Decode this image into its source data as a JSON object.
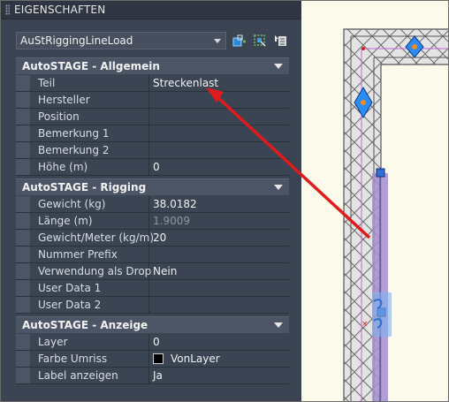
{
  "palette": {
    "title": "EIGENSCHAFTEN"
  },
  "object_selector": {
    "value": "AuStRiggingLineLoad"
  },
  "toolbar": {
    "icons": [
      "quick-select-icon",
      "select-objects-icon",
      "toggle-pickadd-icon"
    ]
  },
  "categories": [
    {
      "title": "AutoSTAGE - Allgemein",
      "rows": [
        {
          "name": "Teil",
          "value": "Streckenlast"
        },
        {
          "name": "Hersteller",
          "value": ""
        },
        {
          "name": "Position",
          "value": ""
        },
        {
          "name": "Bemerkung 1",
          "value": ""
        },
        {
          "name": "Bemerkung 2",
          "value": ""
        },
        {
          "name": "Höhe (m)",
          "value": "0"
        }
      ]
    },
    {
      "title": "AutoSTAGE - Rigging",
      "rows": [
        {
          "name": "Gewicht (kg)",
          "value": "38.0182"
        },
        {
          "name": "Länge (m)",
          "value": "1.9009"
        },
        {
          "name": "Gewicht/Meter (kg/m)",
          "value": "20"
        },
        {
          "name": "Nummer Prefix",
          "value": ""
        },
        {
          "name": "Verwendung als Drop",
          "value": "Nein"
        },
        {
          "name": "User Data 1",
          "value": ""
        },
        {
          "name": "User Data 2",
          "value": ""
        }
      ]
    },
    {
      "title": "AutoSTAGE - Anzeige",
      "rows": [
        {
          "name": "Layer",
          "value": "0"
        },
        {
          "name": "Farbe Umriss",
          "value": "VonLayer"
        },
        {
          "name": "Label anzeigen",
          "value": "Ja"
        }
      ]
    }
  ],
  "colors": {
    "annotation_arrow": "#e01b1b",
    "selection_blue": "#2f6fd6",
    "truss_fill": "#e6e6e6",
    "load_highlight": "#a58fd0"
  }
}
